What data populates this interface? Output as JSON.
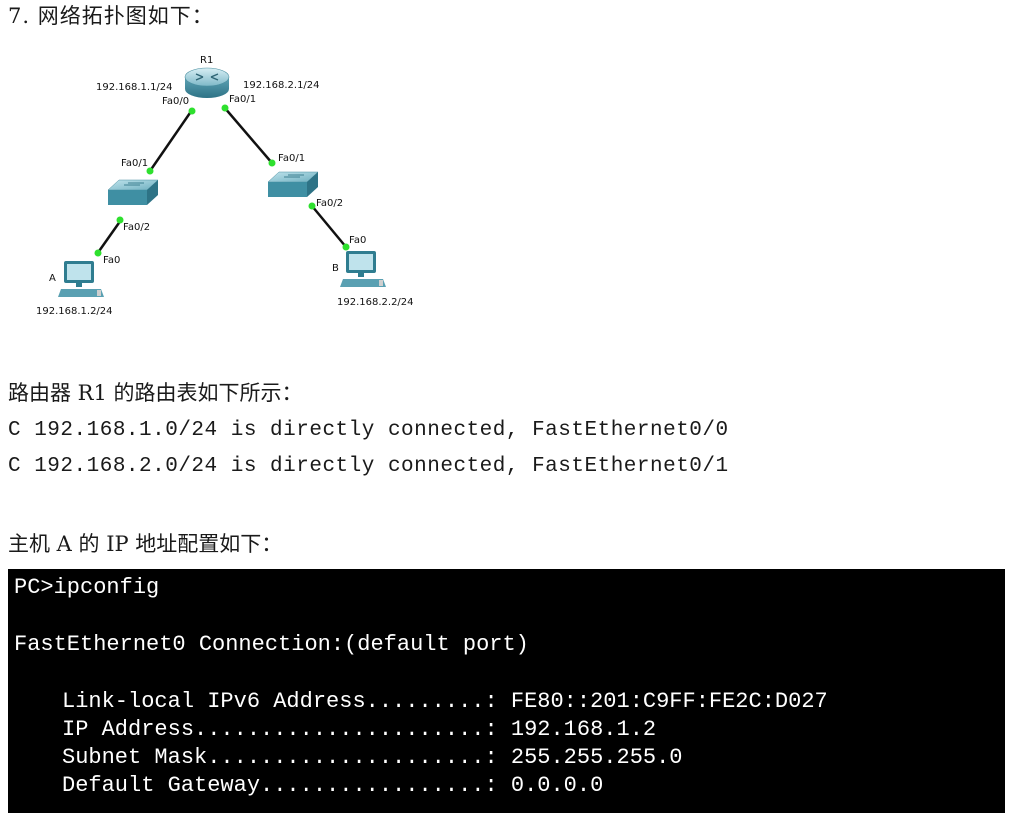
{
  "question": {
    "title": "7.  网络拓扑图如下："
  },
  "topology": {
    "router": {
      "name": "R1",
      "ip_left": "192.168.1.1/24",
      "ip_right": "192.168.2.1/24",
      "port_left": "Fa0/0",
      "port_right": "Fa0/1"
    },
    "switch_left": {
      "port_up": "Fa0/1",
      "port_down": "Fa0/2"
    },
    "switch_right": {
      "port_up": "Fa0/1",
      "port_down": "Fa0/2"
    },
    "pc_a": {
      "name": "A",
      "port": "Fa0",
      "ip": "192.168.1.2/24"
    },
    "pc_b": {
      "name": "B",
      "port": "Fa0",
      "ip": "192.168.2.2/24"
    },
    "colors": {
      "link": "#111111",
      "port_dot": "#2ee02e",
      "device": "#3f8fa3"
    }
  },
  "routing": {
    "intro": "路由器 R1 的路由表如下所示：",
    "lines": [
      "C 192.168.1.0/24 is directly connected, FastEthernet0/0",
      "C 192.168.2.0/24 is directly connected, FastEthernet0/1"
    ]
  },
  "hosta": {
    "intro": "主机 A 的 IP 地址配置如下：",
    "console": {
      "prompt": "PC>ipconfig",
      "heading": "FastEthernet0 Connection:(default port)",
      "rows": [
        "Link-local IPv6 Address.........: FE80::201:C9FF:FE2C:D027",
        "IP Address......................: 192.168.1.2",
        "Subnet Mask.....................: 255.255.255.0",
        "Default Gateway.................: 0.0.0.0"
      ]
    }
  }
}
